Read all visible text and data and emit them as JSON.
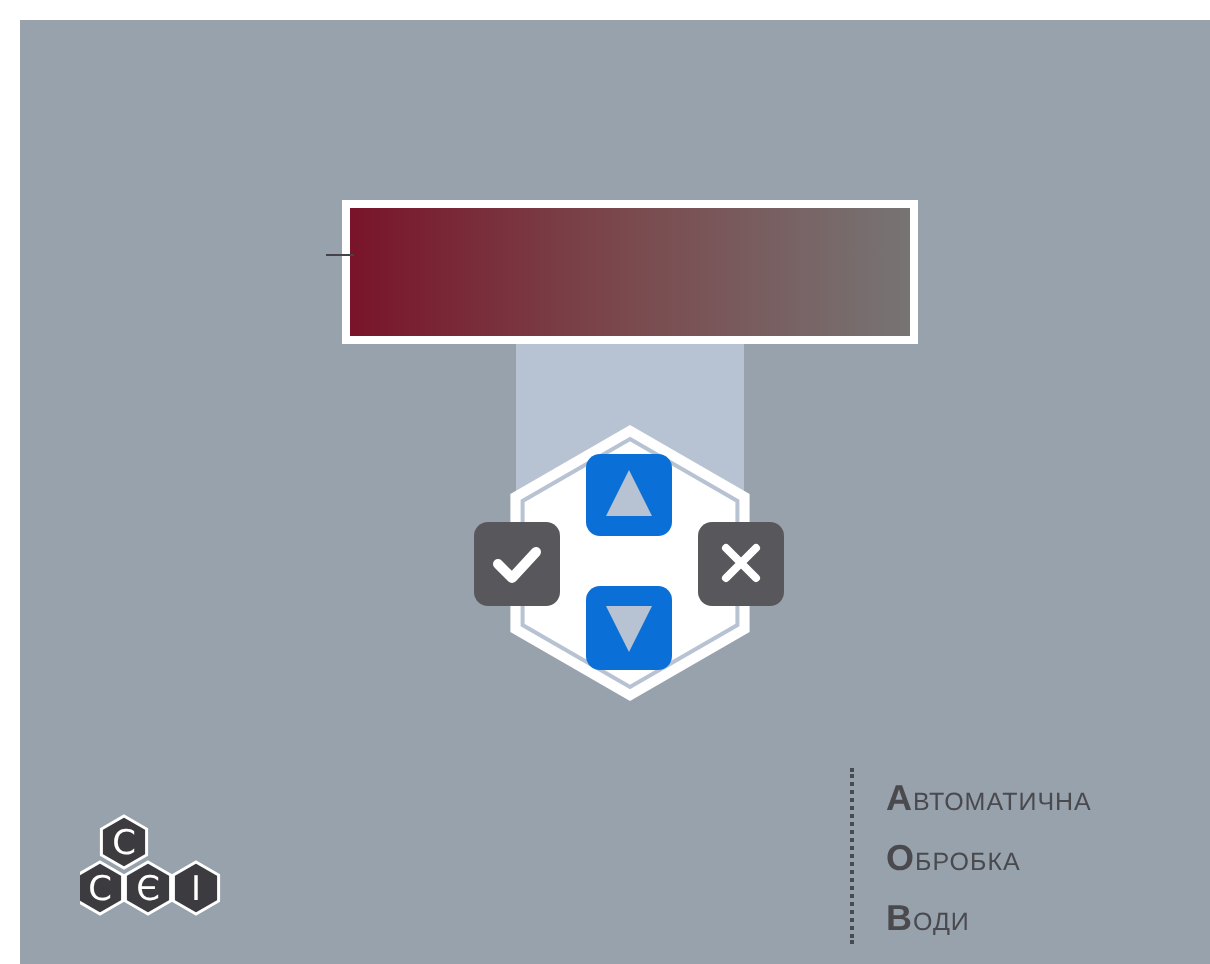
{
  "logo": {
    "letters": [
      "С",
      "С",
      "Є",
      "І"
    ]
  },
  "tagline": [
    "АВТОМАТИЧНА",
    "ОБРОБКА",
    "ВОДИ"
  ]
}
